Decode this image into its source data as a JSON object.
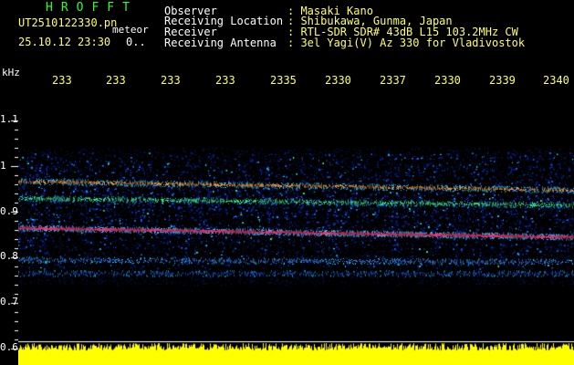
{
  "header": {
    "brand": "HROFFT",
    "filename": "UT2510122330.pn",
    "meteor_label": "meteor",
    "timestamp": "25.10.12 23:30",
    "count": "0..",
    "info": [
      {
        "label": "Observer",
        "value": ": Masaki Kano"
      },
      {
        "label": "Receiving Location",
        "value": ": Shibukawa, Gunma, Japan"
      },
      {
        "label": "Receiver",
        "value": ": RTL-SDR SDR# 43dB L15 103.2MHz CW"
      },
      {
        "label": "Receiving Antenna",
        "value": ": 3el Yagi(V) Az 330 for Vladivostok"
      }
    ]
  },
  "spectrogram": {
    "y_unit": "kHz",
    "time_ticks": [
      "233",
      "233",
      "233",
      "233",
      "2335",
      "2330",
      "2337",
      "2330",
      "2339",
      "2340"
    ],
    "freq_ticks": [
      1.1,
      1.0,
      0.9,
      0.8,
      0.7,
      0.6
    ],
    "freq_range": [
      0.58,
      1.2
    ],
    "signals": [
      {
        "freq_start": 0.865,
        "freq_end": 0.845,
        "color": "#ff3070",
        "strength": 1.0
      },
      {
        "freq_start": 0.967,
        "freq_end": 0.948,
        "color": "#ffa040",
        "strength": 0.6
      },
      {
        "freq_start": 0.93,
        "freq_end": 0.915,
        "color": "#40ff80",
        "strength": 0.5
      },
      {
        "freq_start": 0.795,
        "freq_end": 0.79,
        "color": "#4080ff",
        "strength": 0.35
      },
      {
        "freq_start": 0.765,
        "freq_end": 0.765,
        "color": "#2060ff",
        "strength": 0.3
      }
    ],
    "noise_band": [
      0.775,
      1.03
    ],
    "amplitude_color": "#ffff00"
  }
}
